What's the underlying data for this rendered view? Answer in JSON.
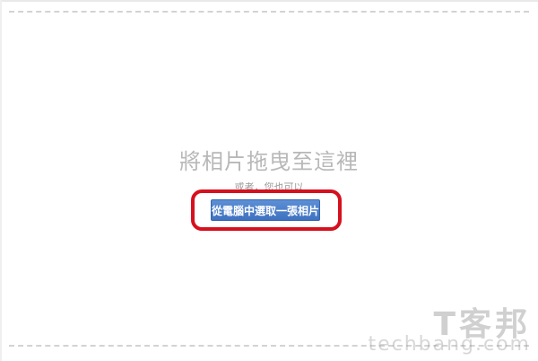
{
  "upload": {
    "drop_title": "將相片拖曳至這裡",
    "or_text": "或者，您也可以",
    "choose_button_label": "從電腦中選取一張相片"
  },
  "watermark": {
    "logo": "T客邦",
    "url": "techbang.com"
  }
}
